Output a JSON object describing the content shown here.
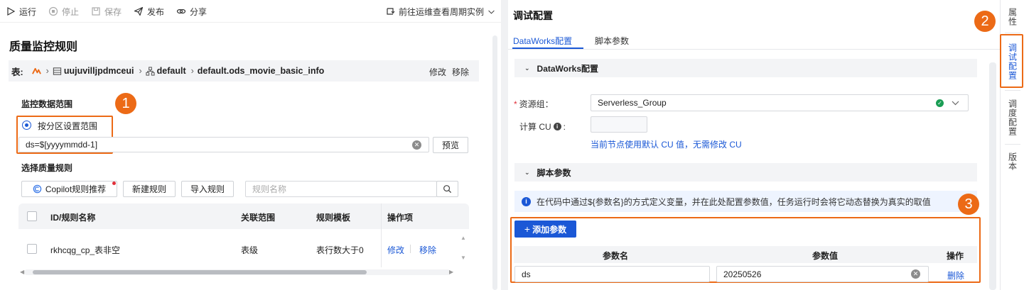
{
  "toolbar": {
    "run": "运行",
    "stop": "停止",
    "save": "保存",
    "publish": "发布",
    "share": "分享",
    "goto_ops": "前往运维查看周期实例"
  },
  "left": {
    "title": "质量监控规则",
    "breadcrumb": {
      "label": "表:",
      "datasource": "uujuvilljpdmceui",
      "schema": "default",
      "table": "default.ods_movie_basic_info",
      "edit": "修改",
      "remove": "移除"
    },
    "scope": {
      "heading": "监控数据范围",
      "radio_label": "按分区设置范围",
      "partition_value": "ds=$[yyyymmdd-1]",
      "preview": "预览"
    },
    "rules": {
      "heading": "选择质量规则",
      "copilot": "Copilot规则推荐",
      "new_rule": "新建规则",
      "import_rule": "导入规则",
      "search_placeholder": "规则名称",
      "columns": [
        "ID/规则名称",
        "关联范围",
        "规则模板",
        "操作项"
      ],
      "rows": [
        {
          "name": "rkhcqg_cp_表非空",
          "scope": "表级",
          "template": "表行数大于0",
          "edit": "修改",
          "remove": "移除"
        }
      ]
    },
    "step_badge": "1"
  },
  "right": {
    "title": "调试配置",
    "tabs": [
      "DataWorks配置",
      "脚本参数"
    ],
    "active_tab": 0,
    "dataworks_section": "DataWorks配置",
    "resource_group_label": "资源组：",
    "resource_group_value": "Serverless_Group",
    "compute_cu_label": "计算 CU",
    "cu_hint": "当前节点使用默认 CU 值，无需修改 CU",
    "script_section": "脚本参数",
    "info_text": "在代码中通过${参数名}的方式定义变量，并在此处配置参数值，任务运行时会将它动态替换为真实的取值",
    "add_param": "添加参数",
    "param_columns": [
      "参数名",
      "参数值",
      "操作"
    ],
    "params": [
      {
        "name": "ds",
        "value": "20250526",
        "action": "删除"
      }
    ],
    "step_badge_2": "2",
    "step_badge_3": "3"
  },
  "rail": {
    "items": [
      "属性",
      "调试配置",
      "调度配置",
      "版本"
    ],
    "active": 1
  },
  "colors": {
    "accent": "#1b58d6",
    "highlight": "#ec6a16",
    "success": "#1a9d54"
  }
}
